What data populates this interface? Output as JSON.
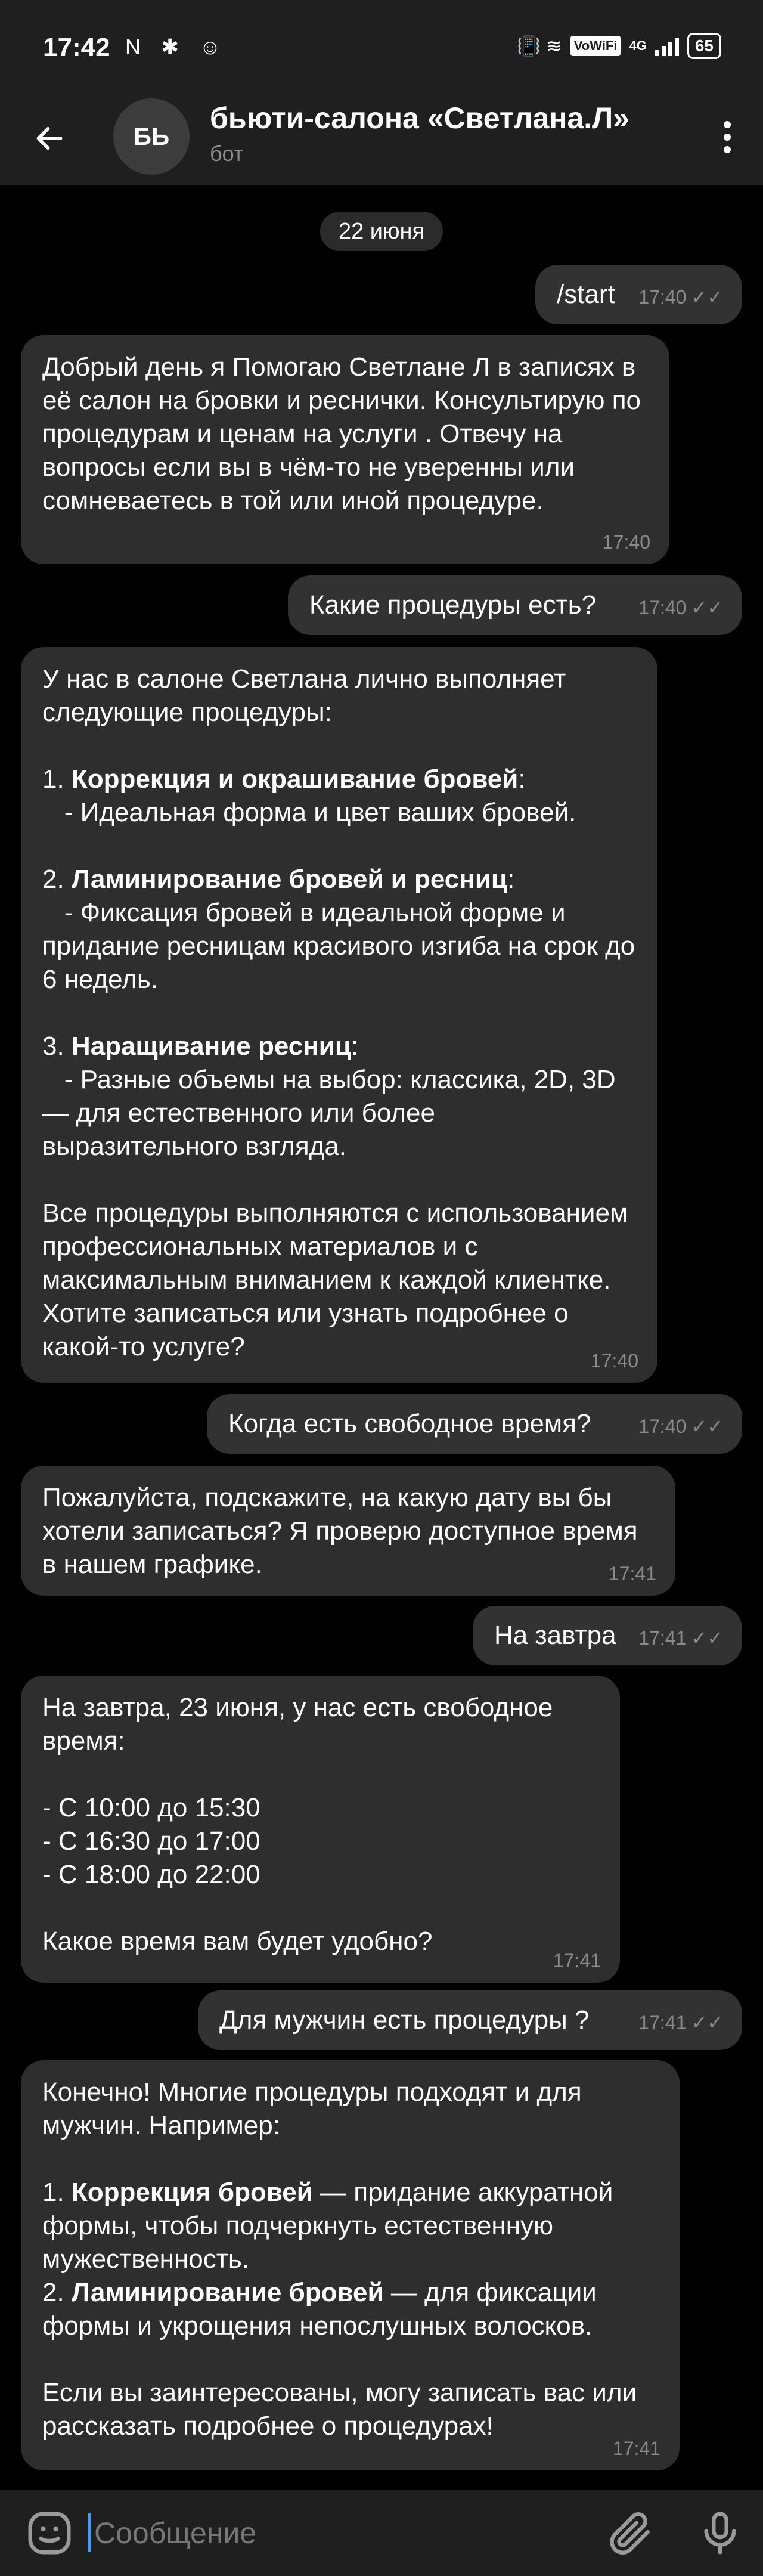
{
  "status_bar": {
    "time": "17:42",
    "left_icons": "N ✱ ☺",
    "right_icons": "📳 ≋",
    "network": "4G",
    "vowifi": "VoWiFi",
    "battery": "65"
  },
  "header": {
    "avatar_initials": "БЬ",
    "title": "бьюти-салона «Светлана.Л»",
    "subtitle": "бот"
  },
  "date_chip": "22 июня",
  "messages": [
    {
      "dir": "out",
      "text": "/start",
      "time": "17:40"
    },
    {
      "dir": "in",
      "text": "Добрый день я Помогаю Светлане Л в записях в её салон на бровки и реснички. Консультирую по процедурам и ценам на услуги . Отвечу на вопросы если вы в чём-то не уверенны или сомневаетесь в той или иной процедуре.",
      "time": "17:40"
    },
    {
      "dir": "out",
      "text": "Какие процедуры есть?",
      "time": "17:40"
    },
    {
      "dir": "in",
      "parts": [
        "У нас в салоне Светлана лично выполняет следующие процедуры:",
        "",
        "1. ",
        "Коррекция и окрашивание бровей",
        ":",
        "   - Идеальная форма и цвет ваших бровей.",
        "",
        "2. ",
        "Ламинирование бровей и ресниц",
        ":",
        "   - Фиксация бровей в идеальной форме и придание ресницам красивого изгиба на срок до 6 недель.",
        "",
        "3. ",
        "Наращивание ресниц",
        ":",
        "   - Разные объемы на выбор: классика, 2D, 3D — для естественного или более выразительного взгляда.",
        "",
        "Все процедуры выполняются с использованием профессиональных материалов и с максимальным вниманием к каждой клиентке. Хотите записаться или узнать подробнее о какой-то услуге?"
      ],
      "time": "17:40"
    },
    {
      "dir": "out",
      "text": "Когда есть свободное время?",
      "time": "17:40"
    },
    {
      "dir": "in",
      "text": "Пожалуйста, подскажите, на какую дату вы бы хотели записаться? Я проверю доступное время в нашем графике.",
      "time": "17:41"
    },
    {
      "dir": "out",
      "text": "На завтра",
      "time": "17:41"
    },
    {
      "dir": "in",
      "parts": [
        "На завтра, 23 июня, у нас есть свободное время:",
        "",
        "- С 10:00 до 15:30",
        "- С 16:30 до 17:00",
        "- С 18:00 до 22:00",
        "",
        "Какое время вам будет удобно?"
      ],
      "time": "17:41"
    },
    {
      "dir": "out",
      "text": "Для мужчин есть процедуры ?",
      "time": "17:41"
    },
    {
      "dir": "in",
      "parts": [
        "Конечно! Многие процедуры подходят и для мужчин. Например:",
        "",
        "1. ",
        "Коррекция бровей",
        " — придание аккуратной формы, чтобы подчеркнуть естественную мужественность.",
        "2. ",
        "Ламинирование бровей",
        " — для фиксации формы и укрощения непослушных волосков.",
        "",
        "Если вы заинтересованы, могу записать вас или рассказать подробнее о процедурах!"
      ],
      "time": "17:41"
    }
  ],
  "input": {
    "placeholder": "Сообщение"
  },
  "icons": {
    "back": "arrow-left-icon",
    "menu": "more-vertical-icon",
    "emoji": "emoji-icon",
    "attach": "paperclip-icon",
    "mic": "microphone-icon",
    "read": "double-check-icon"
  },
  "colors": {
    "background": "#000000",
    "bar": "#1f1f1f",
    "bubble": "#2e2e2e",
    "meta": "#8a8a8a",
    "cursor": "#3e9bff"
  }
}
